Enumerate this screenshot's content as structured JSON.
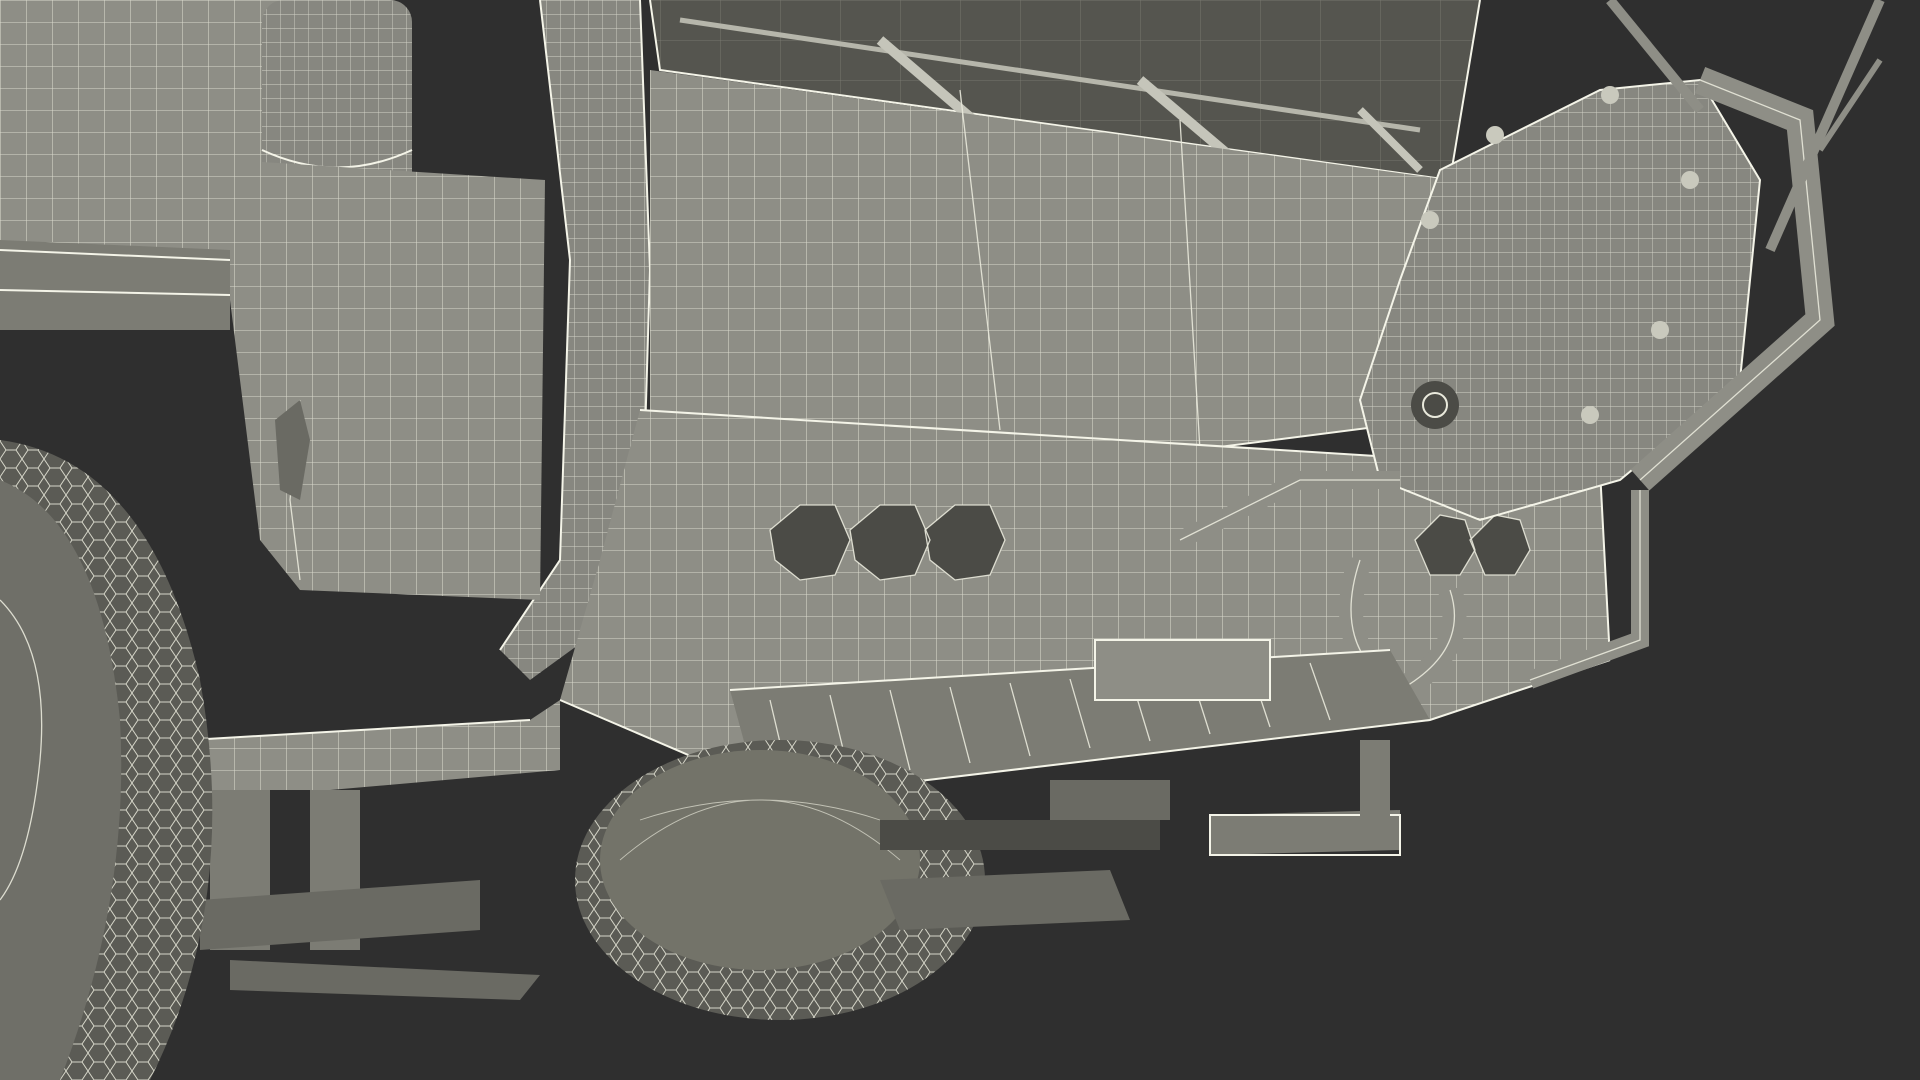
{
  "scene": {
    "subject": "truck-front-wireframe",
    "background_color": "#2f2f2f",
    "mesh_color": "#8e8e86",
    "wire_color": "#e9e9dc"
  }
}
